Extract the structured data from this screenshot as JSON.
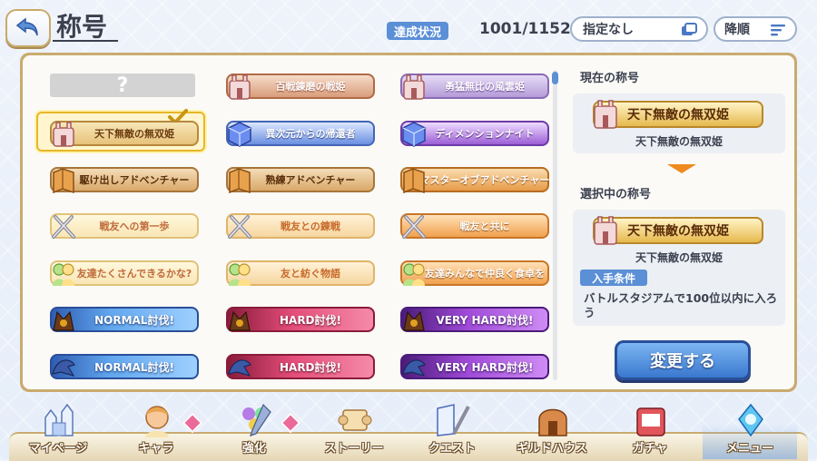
{
  "header": {
    "title": "称号",
    "achievement_label": "達成状況",
    "achievement_value": "1001/1152",
    "filter_label": "指定なし",
    "sort_label": "降順"
  },
  "titles": [
    {
      "label": "?",
      "style": "unknown",
      "emblem": "none"
    },
    {
      "label": "百戦錬磨の戦姫",
      "style": "rose",
      "emblem": "castle"
    },
    {
      "label": "勇猛無比の風雲姫",
      "style": "lav",
      "emblem": "castle"
    },
    {
      "label": "天下無敵の無双姫",
      "style": "gold",
      "emblem": "castle",
      "selected": true
    },
    {
      "label": "異次元からの帰還者",
      "style": "blue",
      "emblem": "cube"
    },
    {
      "label": "ディメンションナイト",
      "style": "purple",
      "emblem": "cube"
    },
    {
      "label": "駆け出しアドベンチャー",
      "style": "tan",
      "emblem": "map"
    },
    {
      "label": "熟練アドベンチャー",
      "style": "tan",
      "emblem": "map"
    },
    {
      "label": "マスターオブアドベンチャー",
      "style": "orange",
      "emblem": "map"
    },
    {
      "label": "戦友への第一歩",
      "style": "cream",
      "emblem": "swords"
    },
    {
      "label": "戦友との錬戦",
      "style": "peach",
      "emblem": "swords"
    },
    {
      "label": "戦友と共に",
      "style": "orange2",
      "emblem": "swords"
    },
    {
      "label": "友達たくさんできるかな?",
      "style": "cream",
      "emblem": "friends"
    },
    {
      "label": "友と紡ぐ物語",
      "style": "peach",
      "emblem": "friends"
    },
    {
      "label": "友達みんなで仲良く食卓を",
      "style": "orange2",
      "emblem": "friends"
    },
    {
      "label": "NORMAL討伐!",
      "style": "nblue",
      "emblem": "boss"
    },
    {
      "label": "HARD討伐!",
      "style": "hard",
      "emblem": "boss"
    },
    {
      "label": "VERY HARD討伐!",
      "style": "vhard",
      "emblem": "boss"
    },
    {
      "label": "NORMAL討伐!",
      "style": "nblue",
      "emblem": "dragon"
    },
    {
      "label": "HARD討伐!",
      "style": "hard",
      "emblem": "dragon"
    },
    {
      "label": "VERY HARD討伐!",
      "style": "vhard",
      "emblem": "dragon"
    }
  ],
  "side": {
    "current_heading": "現在の称号",
    "current_title_badge": "天下無敵の無双姫",
    "current_title_name": "天下無敵の無双姫",
    "selected_heading": "選択中の称号",
    "selected_title_badge": "天下無敵の無双姫",
    "selected_title_name": "天下無敵の無双姫",
    "condition_label": "入手条件",
    "condition_text": "バトルスタジアムで100位以内に入ろう",
    "change_button": "変更する"
  },
  "nav": [
    {
      "label": "マイページ",
      "icon": "castle-icon",
      "badge": false
    },
    {
      "label": "キャラ",
      "icon": "character-icon",
      "badge": true
    },
    {
      "label": "強化",
      "icon": "enhance-icon",
      "badge": true
    },
    {
      "label": "ストーリー",
      "icon": "scroll-icon",
      "badge": false
    },
    {
      "label": "クエスト",
      "icon": "quest-icon",
      "badge": false
    },
    {
      "label": "ギルドハウス",
      "icon": "guild-house-icon",
      "badge": false
    },
    {
      "label": "ガチャ",
      "icon": "gacha-icon",
      "badge": false
    },
    {
      "label": "メニュー",
      "icon": "menu-icon",
      "badge": false,
      "active": true
    }
  ],
  "colors": {
    "accent_blue": "#5b8fd6",
    "gold_border": "#c9ab6f",
    "arrow_orange": "#f08a1e"
  }
}
